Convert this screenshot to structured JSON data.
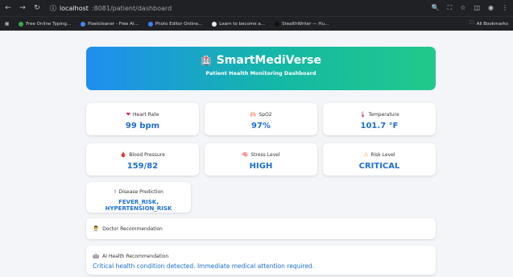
{
  "browser": {
    "url_host": "localhost",
    "url_path": ":8081/patient/dashboard",
    "bookmarks": [
      {
        "label": "Free Online Typing...",
        "color": "#34a853"
      },
      {
        "label": "Pixelcleaner - Free AI...",
        "color": "#4285f4"
      },
      {
        "label": "Photo Editor Online...",
        "color": "#3b82f6"
      },
      {
        "label": "Learn to become a...",
        "color": "#e8eaed"
      },
      {
        "label": "StealthWriter — Hu...",
        "color": "#111111"
      }
    ],
    "all_bookmarks": "All Bookmarks"
  },
  "header": {
    "title": "SmartMediVerse",
    "subtitle": "Patient Health Monitoring Dashboard",
    "icon": "hospital-icon"
  },
  "metrics": [
    {
      "label": "Heart Rate",
      "value": "99 bpm",
      "icon": "heart-icon",
      "glyph": "❤",
      "color": "#e11d48"
    },
    {
      "label": "SpO2",
      "value": "97%",
      "icon": "lungs-icon",
      "glyph": "🫁",
      "color": "#f97316"
    },
    {
      "label": "Temperature",
      "value": "101.7 °F",
      "icon": "thermometer-icon",
      "glyph": "🌡",
      "color": "#b91c1c"
    },
    {
      "label": "Blood Pressure",
      "value": "159/82",
      "icon": "blood-drop-icon",
      "glyph": "🩸",
      "color": "#dc2626"
    },
    {
      "label": "Stress Level",
      "value": "HIGH",
      "icon": "brain-icon",
      "glyph": "🧠",
      "color": "#ec4899"
    },
    {
      "label": "Risk Level",
      "value": "CRITICAL",
      "icon": "warning-icon",
      "glyph": "⚠",
      "color": "#f59e0b"
    }
  ],
  "prediction": {
    "label": "Disease Prediction",
    "value": "FEVER_RISK, HYPERTENSION_RISK",
    "icon": "stethoscope-icon"
  },
  "doctor": {
    "label": "Doctor Recommendation",
    "icon": "doctor-icon"
  },
  "ai": {
    "label": "AI Health Recommendation",
    "message": "Critical health condition detected. Immediate medical attention required.",
    "icon": "robot-icon"
  }
}
